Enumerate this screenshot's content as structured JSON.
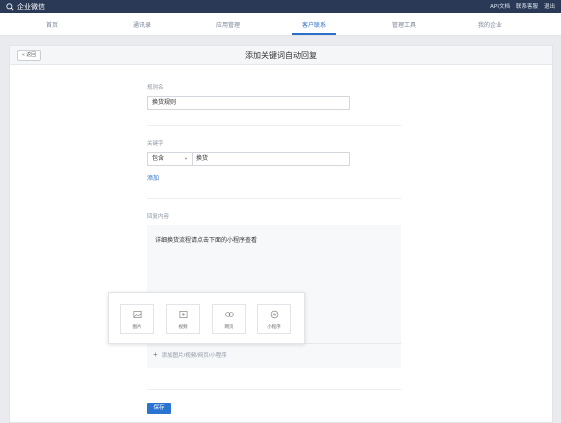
{
  "topbar": {
    "brand": "企业微信",
    "links": [
      "API文档",
      "联系客服",
      "退出"
    ]
  },
  "nav": {
    "items": [
      {
        "label": "首页"
      },
      {
        "label": "通讯录"
      },
      {
        "label": "应用管理"
      },
      {
        "label": "客户联系"
      },
      {
        "label": "管理工具"
      },
      {
        "label": "我的企业"
      }
    ],
    "active": "客户联系"
  },
  "page": {
    "back_label": "« 返回",
    "title": "添加关键词自动回复"
  },
  "form": {
    "rule_name_label": "规则名",
    "rule_name_value": "换货规则",
    "keyword_label": "关键字",
    "match_mode": "包含",
    "keyword_value": "换货",
    "add_keyword_label": "添加",
    "reply_label": "回复内容",
    "reply_text": "详细换货流程请点击下面的小程序查看",
    "add_media_label": "添加图片/视频/网页/小程序",
    "save_label": "保存"
  },
  "media_menu": {
    "items": [
      {
        "label": "图片",
        "icon": "image-icon"
      },
      {
        "label": "视频",
        "icon": "video-icon"
      },
      {
        "label": "网页",
        "icon": "link-icon"
      },
      {
        "label": "小程序",
        "icon": "miniprogram-icon"
      }
    ]
  },
  "colors": {
    "topbar": "#2a3a56",
    "accent": "#2b6ec7",
    "page_bg": "#e9ebee"
  }
}
